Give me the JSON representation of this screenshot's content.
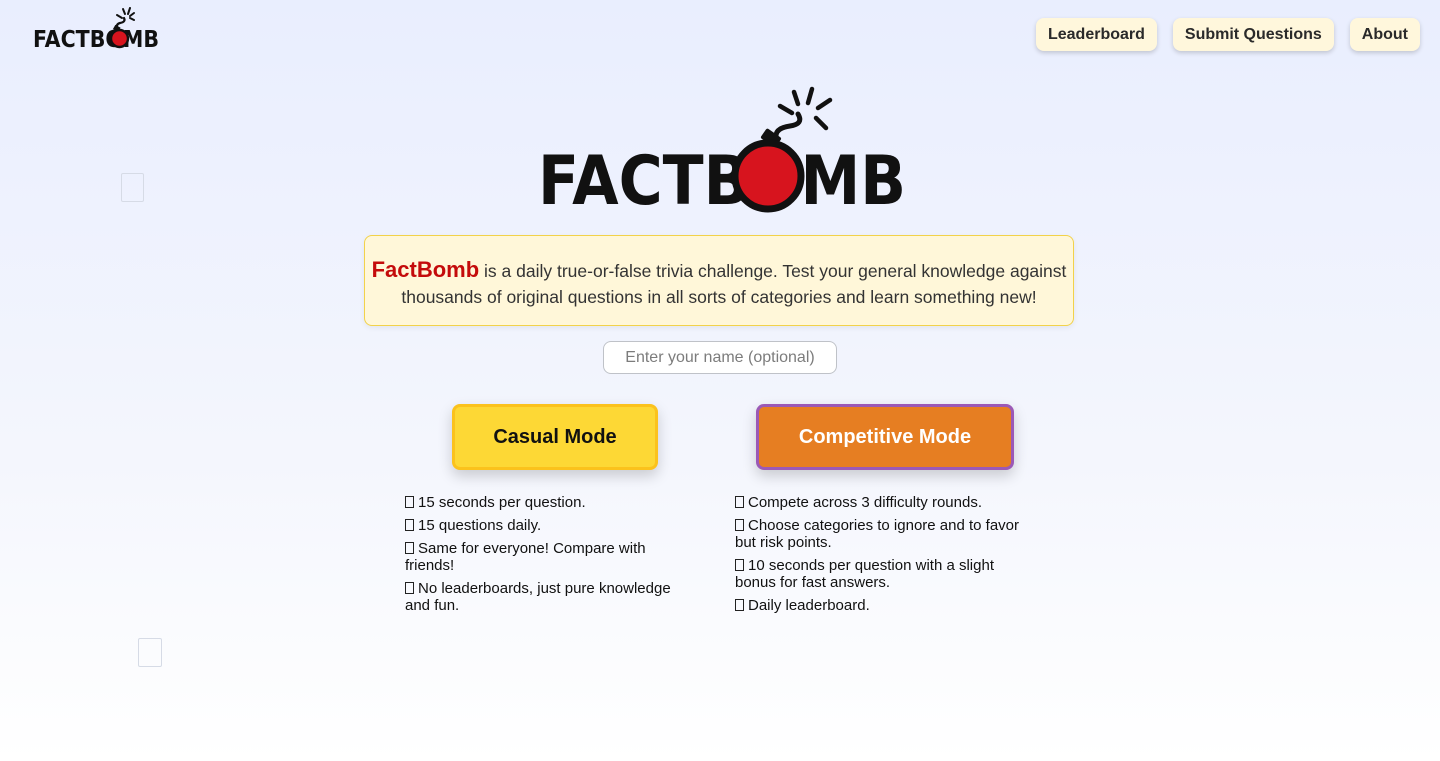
{
  "header": {
    "logo_text": "FACTBOMB",
    "nav": [
      {
        "label": "Leaderboard"
      },
      {
        "label": "Submit Questions"
      },
      {
        "label": "About"
      }
    ]
  },
  "hero": {
    "logo_text": "FACTBOMB"
  },
  "intro": {
    "brand": "FactBomb",
    "text": " is a daily true-or-false trivia challenge. Test your general knowledge against thousands of original questions in all sorts of categories and learn something new!"
  },
  "name_input": {
    "placeholder": "Enter your name (optional)",
    "value": ""
  },
  "modes": {
    "casual": {
      "label": "Casual Mode",
      "features": [
        "15 seconds per question.",
        "15 questions daily.",
        "Same for everyone! Compare with friends!",
        "No leaderboards, just pure knowledge and fun."
      ]
    },
    "competitive": {
      "label": "Competitive Mode",
      "features": [
        "Compete across 3 difficulty rounds.",
        "Choose categories to ignore and to favor but risk points.",
        "10 seconds per question with a slight bonus for fast answers.",
        "Daily leaderboard."
      ]
    }
  },
  "colors": {
    "brand_red": "#c40b0b",
    "bomb_red": "#d7141e",
    "casual_yellow": "#fdd835",
    "competitive_orange": "#e67e22",
    "competitive_border": "#9b59b6",
    "intro_bg": "#fff7d9"
  },
  "icons": {
    "logo": "bomb-icon",
    "feature_bullet": "missing-glyph-icon",
    "decorations": "card-outline-icon"
  }
}
